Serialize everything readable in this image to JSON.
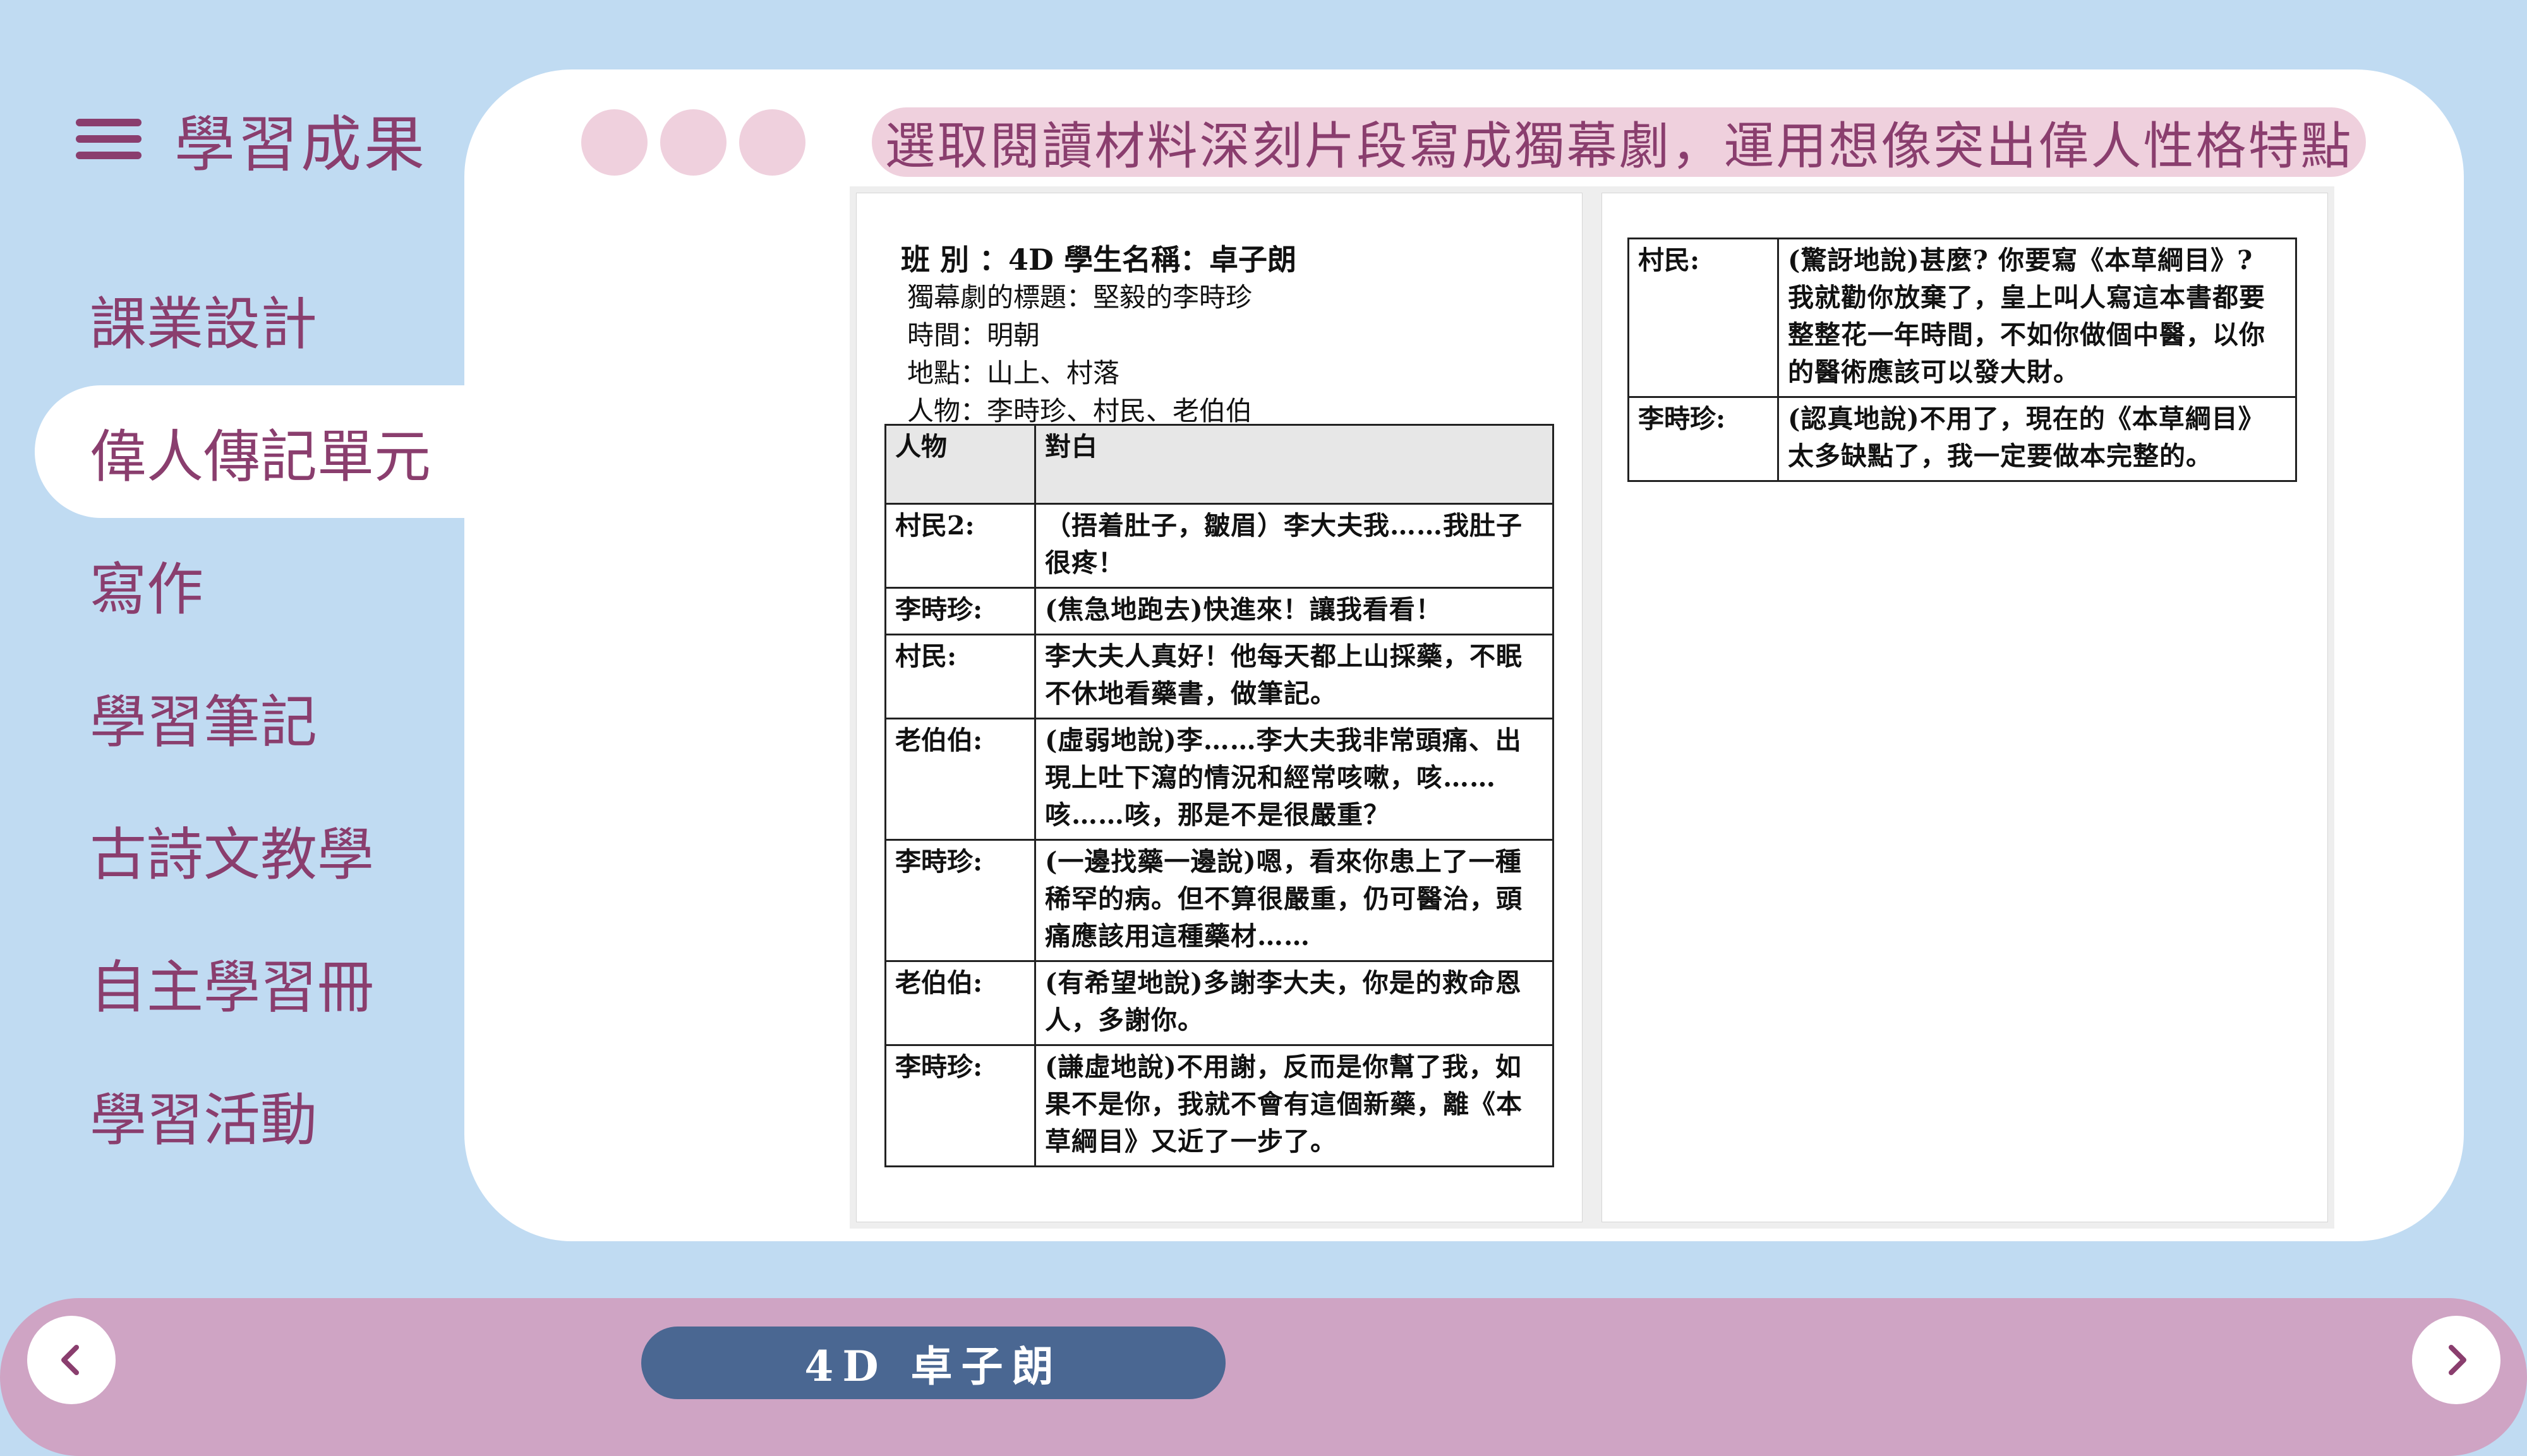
{
  "sidebar": {
    "title": "學習成果",
    "items": [
      {
        "label": "課業設計"
      },
      {
        "label": "偉人傳記單元",
        "active": true
      },
      {
        "label": "寫作"
      },
      {
        "label": "學習筆記"
      },
      {
        "label": "古詩文教學"
      },
      {
        "label": "自主學習冊"
      },
      {
        "label": "學習活動"
      }
    ]
  },
  "headline": "選取閱讀材料深刻片段寫成獨幕劇，運用想像突出偉人性格特點",
  "document": {
    "class_line": "班 別 ：4D   學生名稱：卓子朗",
    "title_line": "獨幕劇的標題：堅毅的李時珍",
    "time_line": "時間：明朝",
    "place_line": "地點：山上、村落",
    "people_line": "人物：李時珍、村民、老伯伯",
    "headers": {
      "speaker": "人物",
      "line": "對白"
    },
    "rows_left": [
      {
        "speaker": "村民2:",
        "line": "（捂着肚子，皺眉）李大夫我……我肚子很疼！"
      },
      {
        "speaker": "李時珍:",
        "line": "(焦急地跑去)快進來！讓我看看！"
      },
      {
        "speaker": "村民:",
        "line": "李大夫人真好！他每天都上山採藥，不眠不休地看藥書，做筆記。"
      },
      {
        "speaker": "老伯伯:",
        "line": "(虛弱地說)李……李大夫我非常頭痛、出現上吐下瀉的情況和經常咳嗽，咳……咳……咳，那是不是很嚴重？"
      },
      {
        "speaker": "李時珍:",
        "line": "(一邊找藥一邊說)嗯，看來你患上了一種稀罕的病。但不算很嚴重，仍可醫治，頭痛應該用這種藥材……"
      },
      {
        "speaker": "老伯伯:",
        "line": "(有希望地說)多謝李大夫，你是的救命恩人，多謝你。"
      },
      {
        "speaker": "李時珍:",
        "line": "(謙虛地說)不用謝，反而是你幫了我，如果不是你，我就不會有這個新藥，離《本草綱目》又近了一步了。"
      }
    ],
    "rows_right": [
      {
        "speaker": "村民:",
        "line": "(驚訝地說)甚麼? 你要寫《本草綱目》? 我就勸你放棄了，皇上叫人寫這本書都要整整花一年時間，不如你做個中醫，以你的醫術應該可以發大財。"
      },
      {
        "speaker": "李時珍:",
        "line": "(認真地說)不用了，現在的《本草綱目》太多缺點了，我一定要做本完整的。"
      }
    ]
  },
  "footer": {
    "student_label": "4D 卓子朗",
    "prev_icon": "chevron-left-icon",
    "next_icon": "chevron-right-icon"
  },
  "colors": {
    "background": "#c0dbf2",
    "accent": "#8a3e6e",
    "pink": "#efd0dd",
    "bottom_bar": "#cfa4c4",
    "pill": "#4a6792"
  }
}
